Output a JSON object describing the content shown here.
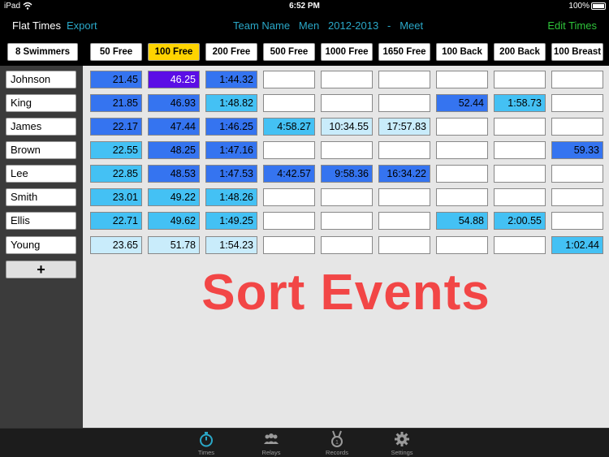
{
  "status_bar": {
    "device": "iPad",
    "time": "6:52 PM",
    "battery": "100%"
  },
  "nav": {
    "title": "Flat Times",
    "export": "Export",
    "center": "Team Name   Men   2012-2013   -   Meet",
    "edit": "Edit Times"
  },
  "swimmer_count": "8 Swimmers",
  "events": [
    "50 Free",
    "100 Free",
    "200 Free",
    "500 Free",
    "1000 Free",
    "1650 Free",
    "100 Back",
    "200 Back",
    "100 Breast"
  ],
  "selected_event": "100 Free",
  "swimmers": [
    "Johnson",
    "King",
    "James",
    "Brown",
    "Lee",
    "Smith",
    "Ellis",
    "Young"
  ],
  "times": [
    [
      "21.45",
      "46.25",
      "1:44.32",
      "",
      "",
      "",
      "",
      "",
      ""
    ],
    [
      "21.85",
      "46.93",
      "1:48.82",
      "",
      "",
      "",
      "52.44",
      "1:58.73",
      ""
    ],
    [
      "22.17",
      "47.44",
      "1:46.25",
      "4:58.27",
      "10:34.55",
      "17:57.83",
      "",
      "",
      ""
    ],
    [
      "22.55",
      "48.25",
      "1:47.16",
      "",
      "",
      "",
      "",
      "",
      "59.33"
    ],
    [
      "22.85",
      "48.53",
      "1:47.53",
      "4:42.57",
      "9:58.36",
      "16:34.22",
      "",
      "",
      ""
    ],
    [
      "23.01",
      "49.22",
      "1:48.26",
      "",
      "",
      "",
      "",
      "",
      ""
    ],
    [
      "22.71",
      "49.62",
      "1:49.25",
      "",
      "",
      "",
      "54.88",
      "2:00.55",
      ""
    ],
    [
      "23.65",
      "51.78",
      "1:54.23",
      "",
      "",
      "",
      "",
      "",
      "1:02.44"
    ]
  ],
  "cell_shades": [
    [
      "blue",
      "purple",
      "blue",
      "",
      "",
      "",
      "",
      "",
      ""
    ],
    [
      "blue",
      "blue",
      "cyan",
      "",
      "",
      "",
      "blue",
      "cyan",
      ""
    ],
    [
      "blue",
      "blue",
      "blue",
      "cyan",
      "light",
      "light",
      "",
      "",
      ""
    ],
    [
      "cyan",
      "blue",
      "blue",
      "",
      "",
      "",
      "",
      "",
      "blue"
    ],
    [
      "cyan",
      "blue",
      "blue",
      "blue",
      "blue",
      "blue",
      "",
      "",
      ""
    ],
    [
      "cyan",
      "cyan",
      "cyan",
      "",
      "",
      "",
      "",
      "",
      ""
    ],
    [
      "cyan",
      "cyan",
      "cyan",
      "",
      "",
      "",
      "cyan",
      "cyan",
      ""
    ],
    [
      "light",
      "light",
      "light",
      "",
      "",
      "",
      "",
      "",
      "cyan"
    ]
  ],
  "add_button": "+",
  "overlay_text": "Sort Events",
  "tabs": [
    {
      "label": "Times",
      "icon": "stopwatch-icon",
      "active": true
    },
    {
      "label": "Relays",
      "icon": "group-icon",
      "active": false
    },
    {
      "label": "Records",
      "icon": "medal-icon",
      "active": false
    },
    {
      "label": "Settings",
      "icon": "gear-icon",
      "active": false
    }
  ],
  "colors": {
    "accent": "#2aa8c8",
    "edit_green": "#2ec43a",
    "selected_header": "#ffd400",
    "shade_blue": "#3574f0",
    "shade_cyan": "#44c1f4",
    "shade_light": "#c9ecfb",
    "shade_purple": "#5b0ee6",
    "overlay_red": "#f24646"
  }
}
